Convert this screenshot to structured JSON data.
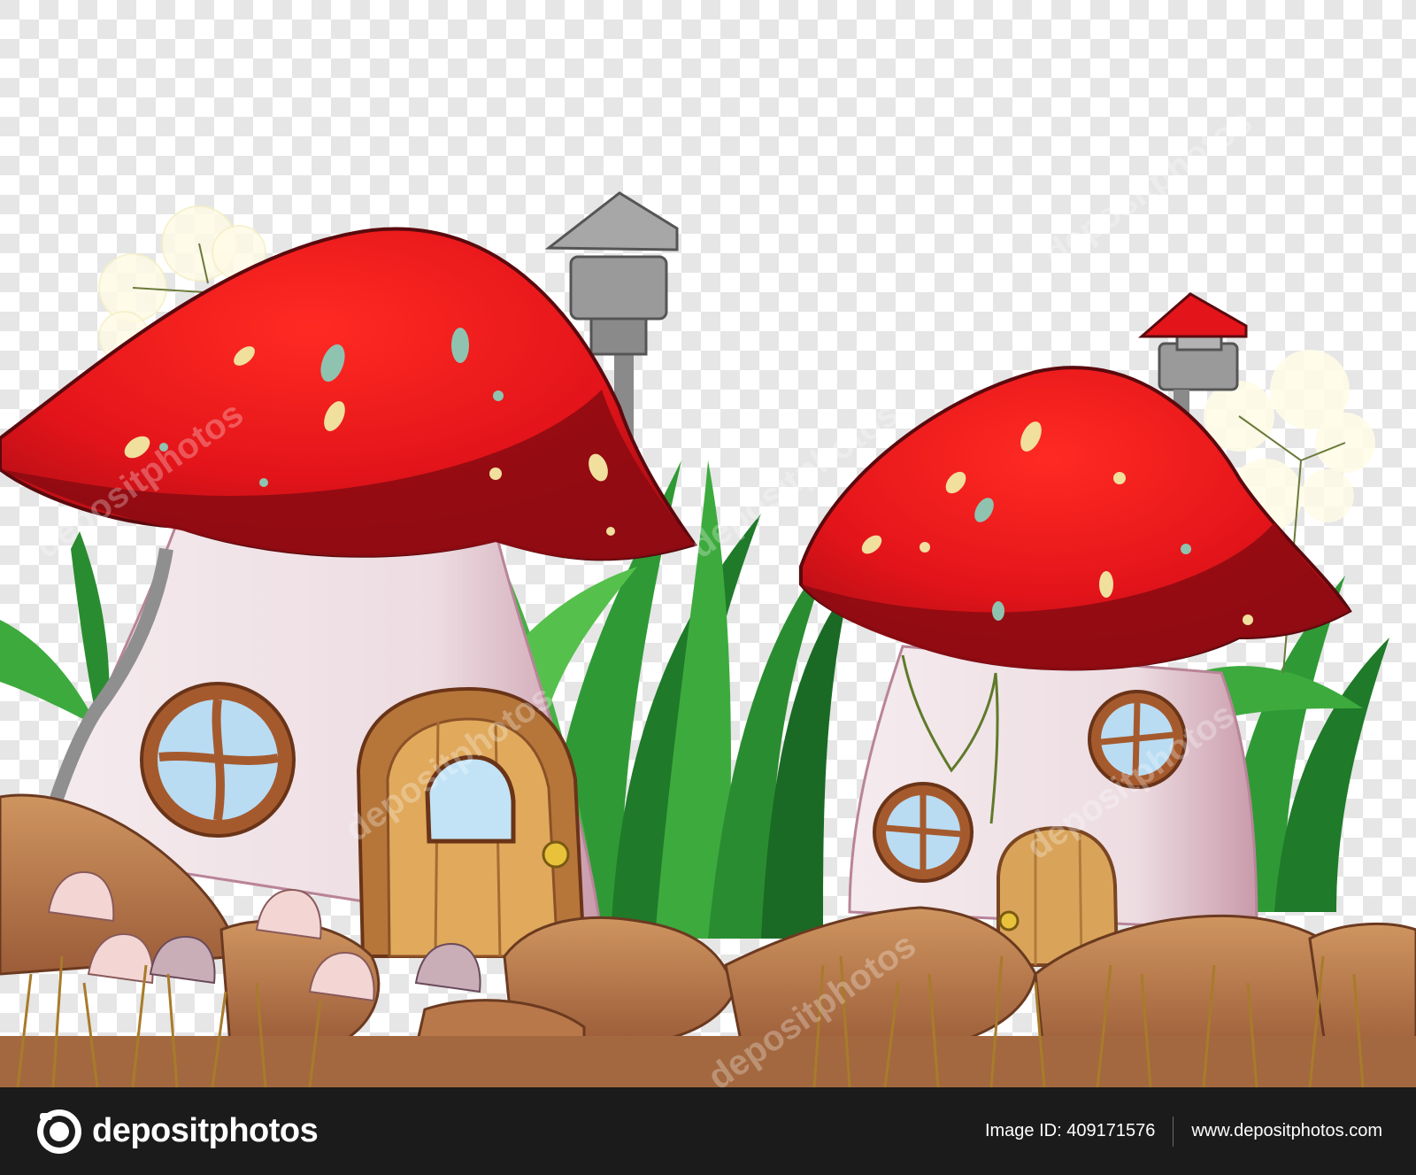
{
  "image": {
    "subject": "two red mushroom houses",
    "background": "transparency-checkerboard"
  },
  "watermark": {
    "text": "depositphotos"
  },
  "footer": {
    "brand": "depositphotos",
    "image_id": "Image ID: 409171576",
    "site_url": "www.depositphotos.com"
  },
  "colors": {
    "cap_red": "#e3141a",
    "cap_dark": "#8e0b12",
    "stem": "#efe2e6",
    "wood": "#d9a45a",
    "rock": "#b9784a",
    "grass": "#2f9a35",
    "footer_bg": "#1b1b1b"
  },
  "icons": [
    "camera-aperture-logo-icon"
  ]
}
